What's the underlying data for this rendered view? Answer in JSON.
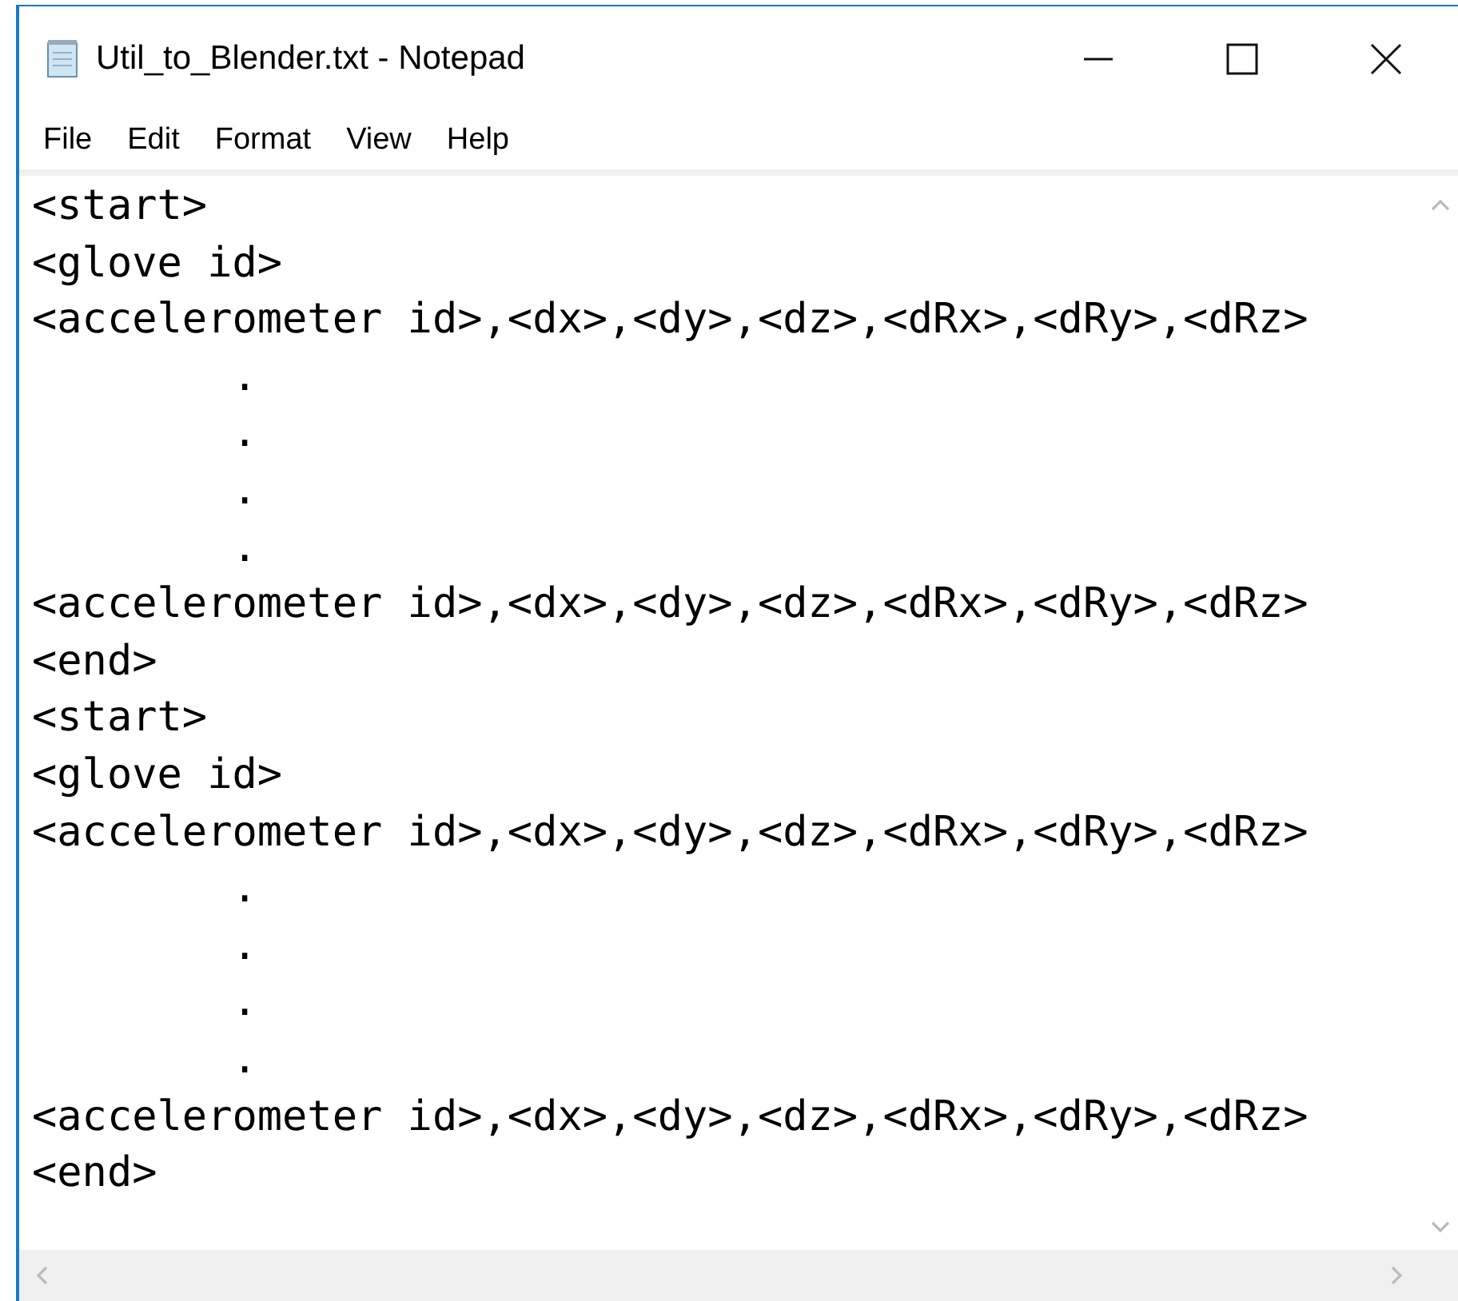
{
  "window": {
    "title": "Util_to_Blender.txt - Notepad"
  },
  "menu": [
    "File",
    "Edit",
    "Format",
    "View",
    "Help"
  ],
  "lines": [
    "<start>",
    "<glove id>",
    "<accelerometer id>,<dx>,<dy>,<dz>,<dRx>,<dRy>,<dRz>",
    "        .",
    "        .",
    "        .",
    "        .",
    "<accelerometer id>,<dx>,<dy>,<dz>,<dRx>,<dRy>,<dRz>",
    "<end>",
    "<start>",
    "<glove id>",
    "<accelerometer id>,<dx>,<dy>,<dz>,<dRx>,<dRy>,<dRz>",
    "        .",
    "        .",
    "        .",
    "        .",
    "<accelerometer id>,<dx>,<dy>,<dz>,<dRx>,<dRy>,<dRz>",
    "<end>"
  ]
}
